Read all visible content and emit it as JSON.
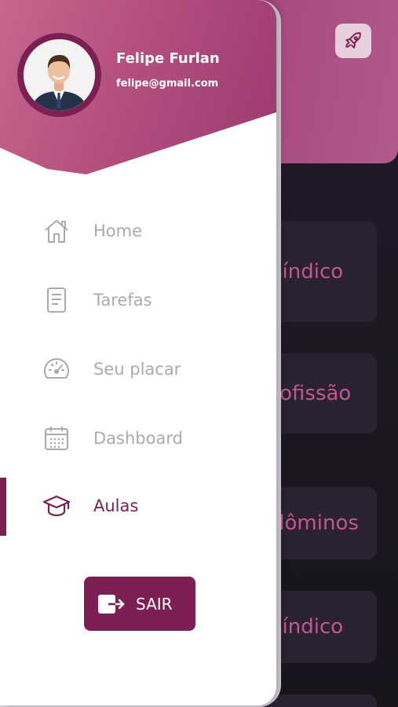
{
  "user": {
    "name": "Felipe Furlan",
    "email": "felipe@gmail.com"
  },
  "menu": {
    "items": [
      {
        "label": "Home",
        "icon": "home-icon",
        "active": false
      },
      {
        "label": "Tarefas",
        "icon": "document-icon",
        "active": false
      },
      {
        "label": "Seu placar",
        "icon": "speedometer-icon",
        "active": false
      },
      {
        "label": "Dashboard",
        "icon": "calendar-icon",
        "active": false
      },
      {
        "label": "Aulas",
        "icon": "graduation-cap-icon",
        "active": true
      }
    ],
    "logout_label": "SAIR",
    "logout_icon": "logout-icon"
  },
  "background": {
    "header_icon": "rocket-icon",
    "cards": [
      {
        "label": "síndico"
      },
      {
        "label": "rofissão"
      },
      {
        "label": "dôminos"
      },
      {
        "label": "síndico"
      }
    ]
  },
  "colors": {
    "accent": "#7c1f52",
    "header_gradient_start": "#c5678e",
    "header_gradient_end": "#9a3a70",
    "inactive_text": "#aaaaaa",
    "background_dark": "#1a1620"
  }
}
